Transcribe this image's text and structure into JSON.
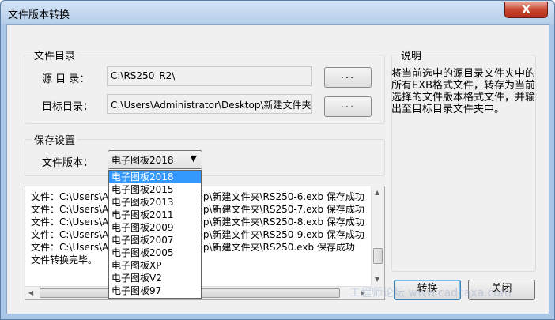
{
  "window": {
    "title": "文件版本转换",
    "close_glyph": "X"
  },
  "file_dir": {
    "group_title": "文件目录",
    "source_label": "源 目 录：",
    "source_value": "C:\\RS250_R2\\",
    "target_label": "目标目录：",
    "target_value": "C:\\Users\\Administrator\\Desktop\\新建文件夹",
    "browse_label": "..."
  },
  "save_settings": {
    "group_title": "保存设置",
    "version_label": "文件版本：",
    "selected": "电子图板2018",
    "options": [
      "电子图板2018",
      "电子图板2015",
      "电子图板2013",
      "电子图板2011",
      "电子图板2009",
      "电子图板2007",
      "电子图板2005",
      "电子图板XP",
      "电子图板V2",
      "电子图板97"
    ]
  },
  "log": {
    "lines": [
      "文件：C:\\Users\\Administrator\\Desktop\\新建文件夹\\RS250-6.exb 保存成功",
      "文件：C:\\Users\\Administrator\\Desktop\\新建文件夹\\RS250-7.exb 保存成功",
      "文件：C:\\Users\\Administrator\\Desktop\\新建文件夹\\RS250-8.exb 保存成功",
      "文件：C:\\Users\\Administrator\\Desktop\\新建文件夹\\RS250-9.exb 保存成功",
      "文件：C:\\Users\\Administrator\\Desktop\\新建文件夹\\RS250.exb 保存成功",
      "文件转换完毕。"
    ]
  },
  "description": {
    "group_title": "说明",
    "text": "将当前选中的源目录文件夹中的所有EXB格式文件，转存为当前选择的文件版本格式文件，并输出至目标目录文件夹中。"
  },
  "buttons": {
    "convert": "转换",
    "close": "关闭"
  },
  "watermark": "工程师论坛 www.cadcaxa.com"
}
